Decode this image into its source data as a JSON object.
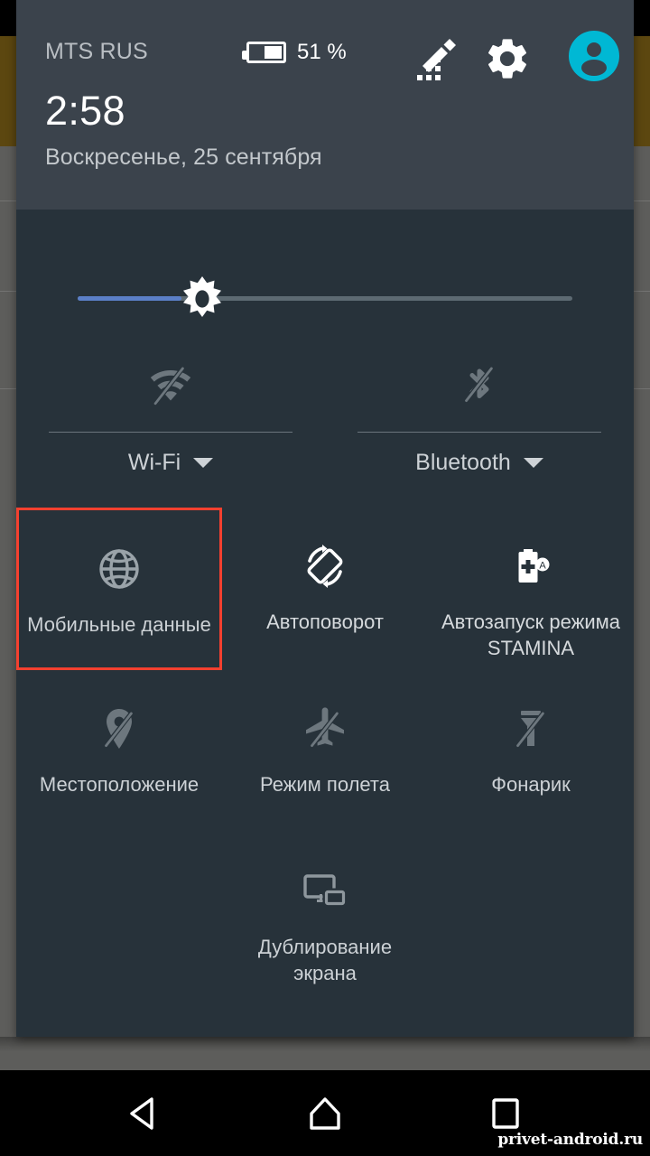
{
  "statusbar": {
    "carrier": "MTS RUS",
    "battery_percent": "51 %",
    "battery_level": 51,
    "edit_icon": "edit-tiles-icon",
    "settings_icon": "gear-icon",
    "avatar_icon": "user-avatar-icon",
    "avatar_color": "#00b8d4"
  },
  "header": {
    "time": "2:58",
    "date": "Воскресенье, 25 сентября"
  },
  "brightness": {
    "name": "brightness-slider",
    "value_percent": 21,
    "fill_color": "#5b7fc7",
    "track_color": "#5d6a72",
    "thumb_icon": "brightness-sun-icon"
  },
  "dual_tiles": [
    {
      "label": "Wi-Fi",
      "icon": "wifi-off-icon",
      "state": "off",
      "has_caret": true
    },
    {
      "label": "Bluetooth",
      "icon": "bluetooth-off-icon",
      "state": "off",
      "has_caret": true
    }
  ],
  "tiles": [
    {
      "label": "Мобильные данные",
      "icon": "globe-icon",
      "state": "off",
      "highlighted": true,
      "highlight_color": "#f4402f"
    },
    {
      "label": "Автоповорот",
      "icon": "auto-rotate-icon",
      "state": "on",
      "highlighted": false
    },
    {
      "label": "Автозапуск режима STAMINA",
      "icon": "stamina-battery-icon",
      "state": "on",
      "highlighted": false
    },
    {
      "label": "Местоположение",
      "icon": "location-off-icon",
      "state": "off",
      "highlighted": false
    },
    {
      "label": "Режим полета",
      "icon": "airplane-off-icon",
      "state": "off",
      "highlighted": false
    },
    {
      "label": "Фонарик",
      "icon": "flashlight-off-icon",
      "state": "off",
      "highlighted": false
    },
    {
      "label": "Дублирование экрана",
      "icon": "screen-mirror-icon",
      "state": "off",
      "highlighted": false
    }
  ],
  "navbar": {
    "back": "back-triangle-icon",
    "home": "home-icon",
    "recents": "recents-square-icon"
  },
  "watermark": "privet-android.ru"
}
